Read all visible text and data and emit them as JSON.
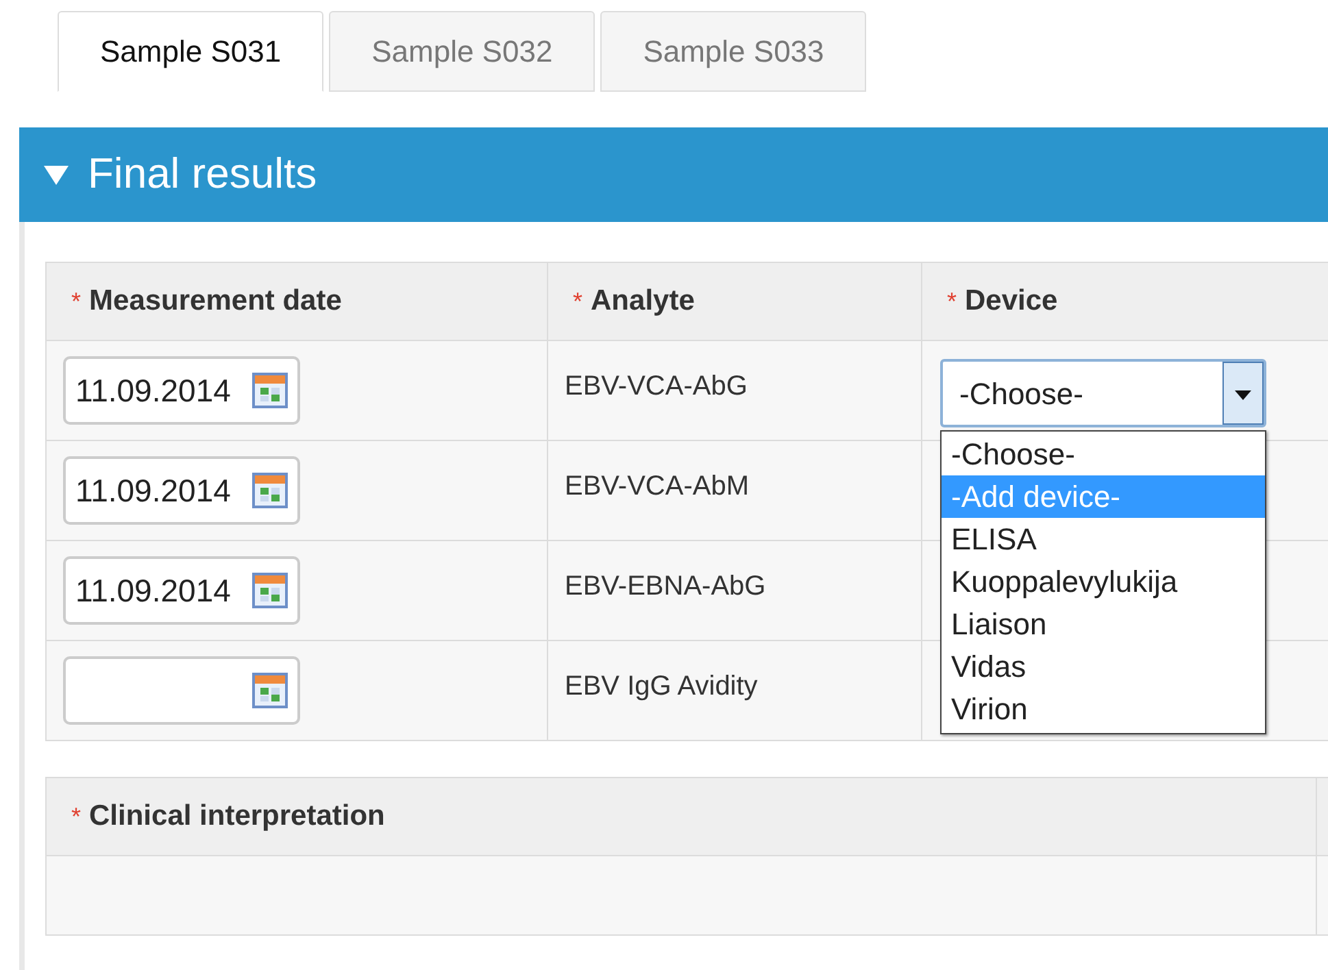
{
  "tabs": [
    {
      "label": "Sample S031",
      "selected": true
    },
    {
      "label": "Sample S032",
      "selected": false
    },
    {
      "label": "Sample S033",
      "selected": false
    }
  ],
  "section": {
    "title": "Final results",
    "expanded": true
  },
  "results_table": {
    "columns": [
      {
        "mark": "*",
        "label": "Measurement date"
      },
      {
        "mark": "*",
        "label": "Analyte"
      },
      {
        "mark": "*",
        "label": "Device"
      }
    ],
    "rows": [
      {
        "date": "11.09.2014",
        "analyte": "EBV-VCA-AbG",
        "device": "-Choose-"
      },
      {
        "date": "11.09.2014",
        "analyte": "EBV-VCA-AbM"
      },
      {
        "date": "11.09.2014",
        "analyte": "EBV-EBNA-AbG"
      },
      {
        "date": "",
        "analyte": "EBV IgG Avidity"
      }
    ]
  },
  "device_dropdown": {
    "options": [
      {
        "label": "-Choose-",
        "selected": false
      },
      {
        "label": "-Add device-",
        "selected": true
      },
      {
        "label": "ELISA",
        "selected": false
      },
      {
        "label": "Kuoppalevylukija",
        "selected": false
      },
      {
        "label": "Liaison",
        "selected": false
      },
      {
        "label": "Vidas",
        "selected": false
      },
      {
        "label": "Virion",
        "selected": false
      }
    ]
  },
  "interpretation_table": {
    "columns": [
      {
        "mark": "*",
        "label": "Clinical interpretation"
      }
    ]
  }
}
